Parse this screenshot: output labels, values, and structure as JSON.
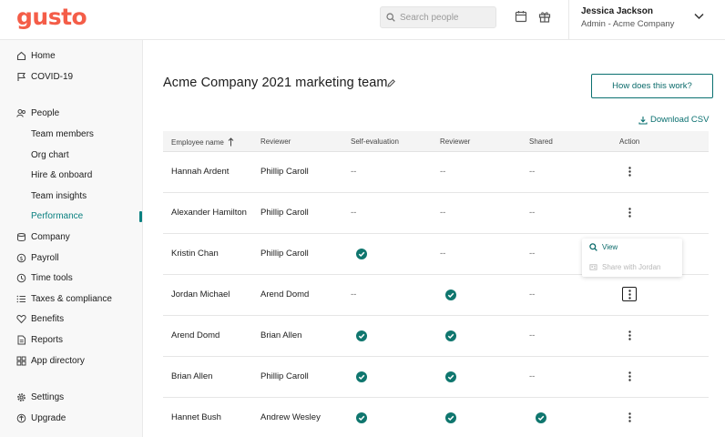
{
  "brand": {
    "logo_text": "gusto",
    "logo_color": "#f45d48",
    "accent_color": "#0a7070"
  },
  "topbar": {
    "search_placeholder": "Search people",
    "user_name": "Jessica Jackson",
    "user_role": "Admin - Acme Company"
  },
  "sidebar": {
    "items": [
      {
        "label": "Home",
        "icon": "home-icon"
      },
      {
        "label": "COVID-19",
        "icon": "flag-icon"
      },
      {
        "label": "People",
        "icon": "people-icon"
      },
      {
        "label": "Company",
        "icon": "company-icon"
      },
      {
        "label": "Payroll",
        "icon": "payroll-icon"
      },
      {
        "label": "Time tools",
        "icon": "clock-icon"
      },
      {
        "label": "Taxes & compliance",
        "icon": "list-icon"
      },
      {
        "label": "Benefits",
        "icon": "heart-icon"
      },
      {
        "label": "Reports",
        "icon": "reports-icon"
      },
      {
        "label": "App directory",
        "icon": "apps-icon"
      },
      {
        "label": "Settings",
        "icon": "gear-icon"
      },
      {
        "label": "Upgrade",
        "icon": "upgrade-icon"
      }
    ],
    "people_sub": [
      {
        "label": "Team members",
        "active": false
      },
      {
        "label": "Org chart",
        "active": false
      },
      {
        "label": "Hire & onboard",
        "active": false
      },
      {
        "label": "Team insights",
        "active": false
      },
      {
        "label": "Performance",
        "active": true
      }
    ]
  },
  "main": {
    "title": "Acme Company 2021 marketing team",
    "how_button": "How does this work?",
    "download_label": "Download CSV"
  },
  "table": {
    "columns": [
      "Employee name",
      "Reviewer",
      "Self-evaluation",
      "Reviewer",
      "Shared",
      "Action"
    ],
    "sort_column": "Employee name",
    "sort_direction": "ascending",
    "rows": [
      {
        "name": "Hannah Ardent",
        "reviewer": "Phillip Caroll",
        "self_eval": "--",
        "reviewer_status": "--",
        "shared": "--"
      },
      {
        "name": "Alexander Hamilton",
        "reviewer": "Phillip Caroll",
        "self_eval": "--",
        "reviewer_status": "--",
        "shared": "--"
      },
      {
        "name": "Kristin Chan",
        "reviewer": "Phillip Caroll",
        "self_eval": "check",
        "reviewer_status": "--",
        "shared": "--"
      },
      {
        "name": "Jordan Michael",
        "reviewer": "Arend Domd",
        "self_eval": "--",
        "reviewer_status": "check",
        "shared": "--"
      },
      {
        "name": "Arend Domd",
        "reviewer": "Brian Allen",
        "self_eval": "check",
        "reviewer_status": "check",
        "shared": "--"
      },
      {
        "name": "Brian Allen",
        "reviewer": "Phillip Caroll",
        "self_eval": "check",
        "reviewer_status": "check",
        "shared": "--"
      },
      {
        "name": "Hannet Bush",
        "reviewer": "Andrew Wesley",
        "self_eval": "check",
        "reviewer_status": "check",
        "shared": "check"
      }
    ],
    "check_color": "#0f766e"
  },
  "action_menu": {
    "open_for_row": 3,
    "items": [
      {
        "label": "View",
        "icon": "search-icon",
        "enabled": true
      },
      {
        "label": "Share with Jordan",
        "icon": "share-icon",
        "enabled": false
      }
    ]
  }
}
